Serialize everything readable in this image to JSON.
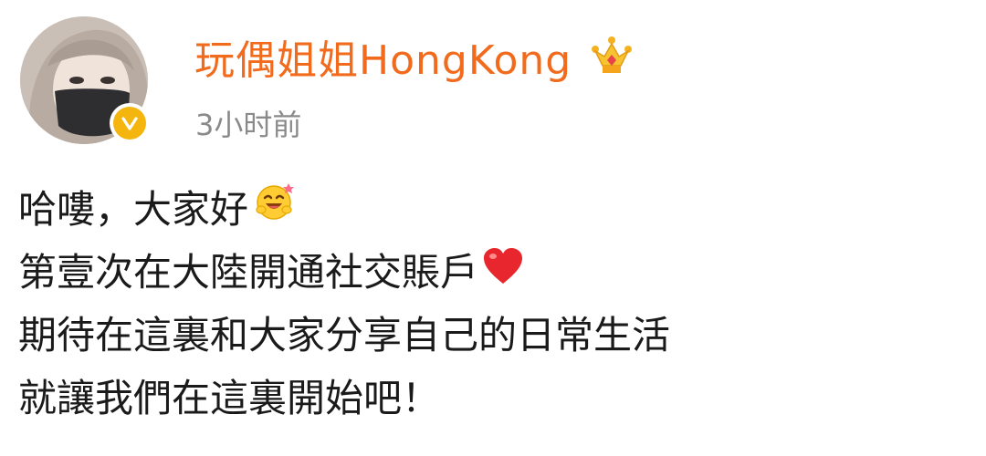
{
  "post": {
    "author": {
      "name": "玩偶姐姐HongKong",
      "avatar_icon": "user-avatar",
      "verified_icon": "verified-badge-icon",
      "vip_icon": "crown-icon",
      "name_color": "#f26b1d"
    },
    "timestamp": "3小时前",
    "lines": [
      {
        "text": "哈嘍，大家好",
        "emoji": "laughing-face-emoji"
      },
      {
        "text": "第壹次在大陸開通社交賬戶",
        "emoji": "red-heart-emoji"
      },
      {
        "text": "期待在這裏和大家分享自己的日常生活",
        "emoji": ""
      },
      {
        "text": "就讓我們在這裏開始吧！",
        "emoji": ""
      }
    ],
    "verified_color": "#f5b50f"
  }
}
